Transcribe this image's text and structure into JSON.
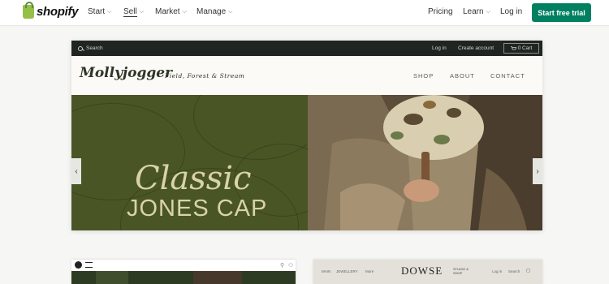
{
  "topnav": {
    "logo_text": "shopify",
    "items": [
      {
        "label": "Start",
        "chevron": true
      },
      {
        "label": "Sell",
        "chevron": true
      },
      {
        "label": "Market",
        "chevron": true
      },
      {
        "label": "Manage",
        "chevron": true
      }
    ],
    "right_items": [
      {
        "label": "Pricing",
        "chevron": false
      },
      {
        "label": "Learn",
        "chevron": true
      },
      {
        "label": "Log in",
        "chevron": false
      }
    ],
    "cta_label": "Start free trial",
    "brand_color": "#008060"
  },
  "store": {
    "utility_bar": {
      "search_label": "Search",
      "login_label": "Log in",
      "account_label": "Create account",
      "cart_label": "0 Cart"
    },
    "brand_name": "Mollyjogger",
    "tagline": "Field, Forest & Stream",
    "menu": [
      "SHOP",
      "ABOUT",
      "CONTACT"
    ],
    "hero": {
      "line1": "Classic",
      "line2": "JONES CAP",
      "prev_icon": "chevron-left-icon",
      "next_icon": "chevron-right-icon"
    }
  },
  "thumbs": {
    "card1_menu_icon": "hamburger-icon",
    "card2": {
      "nav": [
        "MAIN",
        "JEWELLERY",
        "More"
      ],
      "brand": "DOWSE",
      "brand_sub": "STUDIO & SHOP",
      "right": [
        "Log in",
        "Search"
      ]
    }
  }
}
